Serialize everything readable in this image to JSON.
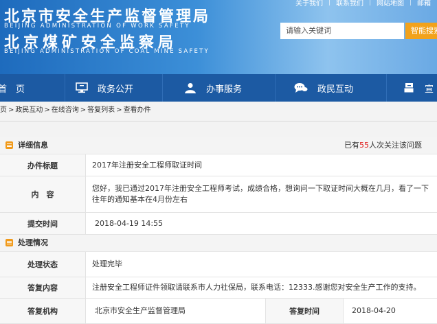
{
  "header": {
    "title_cn_1": "北京市安全生产监督管理局",
    "title_en_1": "BEIJING ADMINISTRATION OF WORK SAFETY",
    "title_cn_2": "北京煤矿安全监察局",
    "title_en_2": "BEIJING ADMINISTRATION OF COAL MINE SAFETY",
    "top_links": [
      "关于我们",
      "联系我们",
      "网站地图",
      "邮箱"
    ],
    "search_placeholder": "请输入关键词",
    "search_button": "智能搜索"
  },
  "nav": {
    "items": [
      {
        "label": "首　页",
        "icon": "home-icon"
      },
      {
        "label": "政务公开",
        "icon": "monitor-icon"
      },
      {
        "label": "办事服务",
        "icon": "user-service-icon"
      },
      {
        "label": "政民互动",
        "icon": "chat-icon"
      },
      {
        "label": "宣",
        "icon": "document-icon"
      }
    ]
  },
  "breadcrumb": [
    "页",
    "政民互动",
    "在线咨询",
    "答复列表",
    "查看办件"
  ],
  "detail": {
    "section_title": "详细信息",
    "attention_prefix": "已有",
    "attention_count": "55",
    "attention_suffix": "人次关注该问题",
    "subject_label": "办件标题",
    "subject_value": "2017年注册安全工程师取证时间",
    "content_label": "内　容",
    "content_value": "您好，我已通过2017年注册安全工程师考试，成绩合格，想询问一下取证时间大概在几月，看了一下往年的通知基本在4月份左右",
    "submit_time_label": "提交时间",
    "submit_time_value": "2018-04-19 14:55"
  },
  "handling": {
    "section_title": "处理情况",
    "status_label": "处理状态",
    "status_value": "处理完毕",
    "reply_content_label": "答复内容",
    "reply_content_value": "注册安全工程师证件领取请联系市人力社保局，联系电话：12333.感谢您对安全生产工作的支持。",
    "reply_org_label": "答复机构",
    "reply_org_value": "北京市安全生产监督管理局",
    "reply_time_label": "答复时间",
    "reply_time_value": "2018-04-20"
  },
  "colors": {
    "nav_bg": "#1c5aa3",
    "accent_orange": "#f19a1a",
    "search_button": "#f2a21b",
    "count_red": "#e02020"
  }
}
